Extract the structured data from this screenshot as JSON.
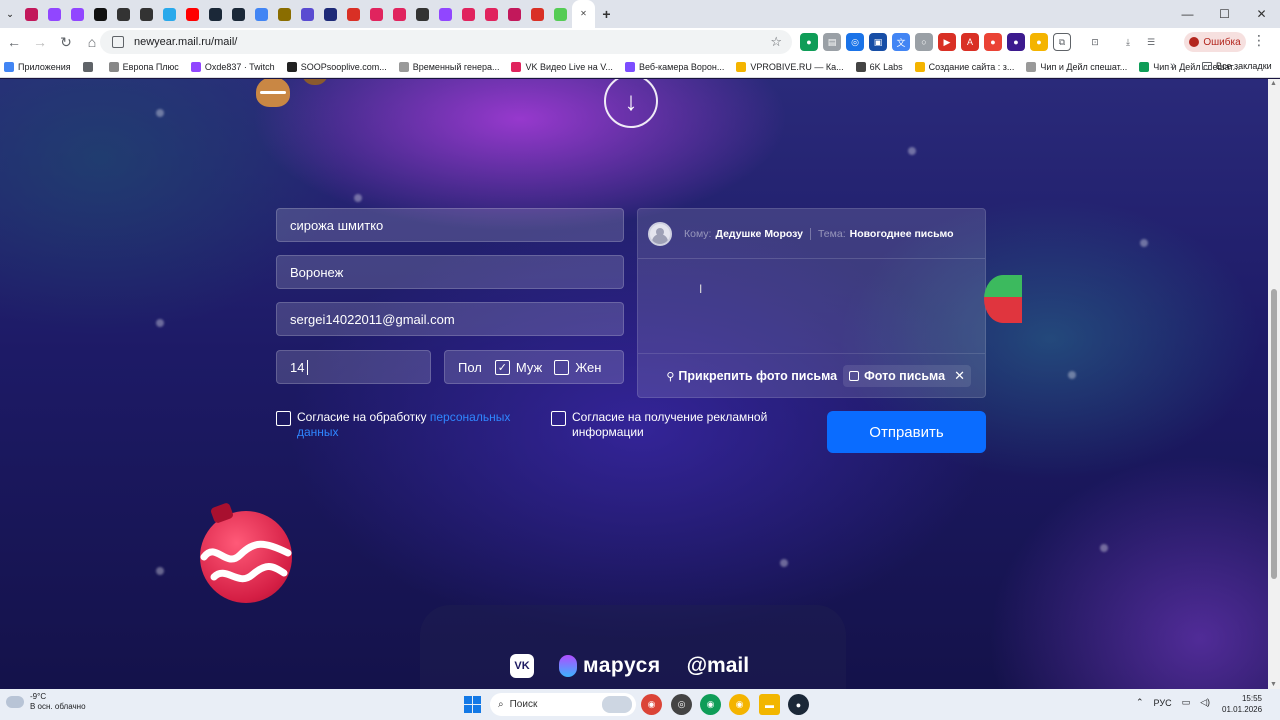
{
  "browser": {
    "tab_count_icons": [
      "mail-tab-icon",
      "twitch-tab-icon",
      "twitch-tab-icon",
      "x-tab-icon",
      "game-tab-icon",
      "game-tab-icon",
      "telegram-tab-icon",
      "youtube-tab-icon",
      "steam-tab-icon",
      "steam-tab-icon",
      "google-tab-icon",
      "game-tab-icon",
      "site-tab-icon",
      "site-tab-icon",
      "mail-tab-icon",
      "live-tab-icon",
      "site-tab-icon",
      "game-tab-icon",
      "twitch-tab-icon",
      "live-tab-icon",
      "site-tab-icon",
      "live-tab-icon",
      "mail-tab-icon",
      "star-tab-icon",
      "active-tab-icon"
    ],
    "url": "newyear.mail.ru/mail/",
    "error_label": "Ошибка",
    "bookmarks": [
      {
        "label": "Приложения",
        "color": "#4285f4"
      },
      {
        "label": "",
        "color": "#5f6368"
      },
      {
        "label": "Европа Плюс",
        "color": "#888888"
      },
      {
        "label": "Oxde837 · Twitch",
        "color": "#9146ff"
      },
      {
        "label": "SOOPsooplive.com...",
        "color": "#222222"
      },
      {
        "label": "Временный генера...",
        "color": "#999999"
      },
      {
        "label": "VK Видео Live на V...",
        "color": "#e0245e"
      },
      {
        "label": "Веб-камера Ворон...",
        "color": "#7c4dff"
      },
      {
        "label": "VPROBIVE.RU — Ка...",
        "color": "#f4b400"
      },
      {
        "label": "6K Labs",
        "color": "#444444"
      },
      {
        "label": "Создание сайта : з...",
        "color": "#f4b400"
      },
      {
        "label": "Чип и Дейл спешат...",
        "color": "#999999"
      },
      {
        "label": "Чип и Дейл спешат...",
        "color": "#0f9d58"
      }
    ],
    "all_bookmarks_label": "Все закладки"
  },
  "form": {
    "name_value": "сирожа шмитко",
    "city_value": "Воронеж",
    "email_value": "sergei14022011@gmail.com",
    "age_value": "14",
    "gender_label": "Пол",
    "male_label": "Муж",
    "male_checked_mark": "✓",
    "female_label": "Жен",
    "consent_personal_prefix": "Согласие на обработку ",
    "consent_personal_link": "персональных данных",
    "consent_ads": "Согласие на получение рекламной информации",
    "send_button": "Отправить"
  },
  "letter": {
    "to_key": "Кому:",
    "to_value": "Дедушке Морозу",
    "subject_key": "Тема:",
    "subject_value": "Новогоднее письмо",
    "attach_label": "Прикрепить фото письма",
    "photo_chip_label": "Фото письма",
    "remove_mark": "✕"
  },
  "footer_logos": {
    "vk": "VK",
    "marusia": "маруся",
    "mail": "@mail"
  },
  "taskbar": {
    "temperature": "-9°C",
    "weather_desc": "В осн. облачно",
    "search_label": "Поиск",
    "language": "РУС",
    "time": "15:55",
    "date": "01.01.2026"
  }
}
